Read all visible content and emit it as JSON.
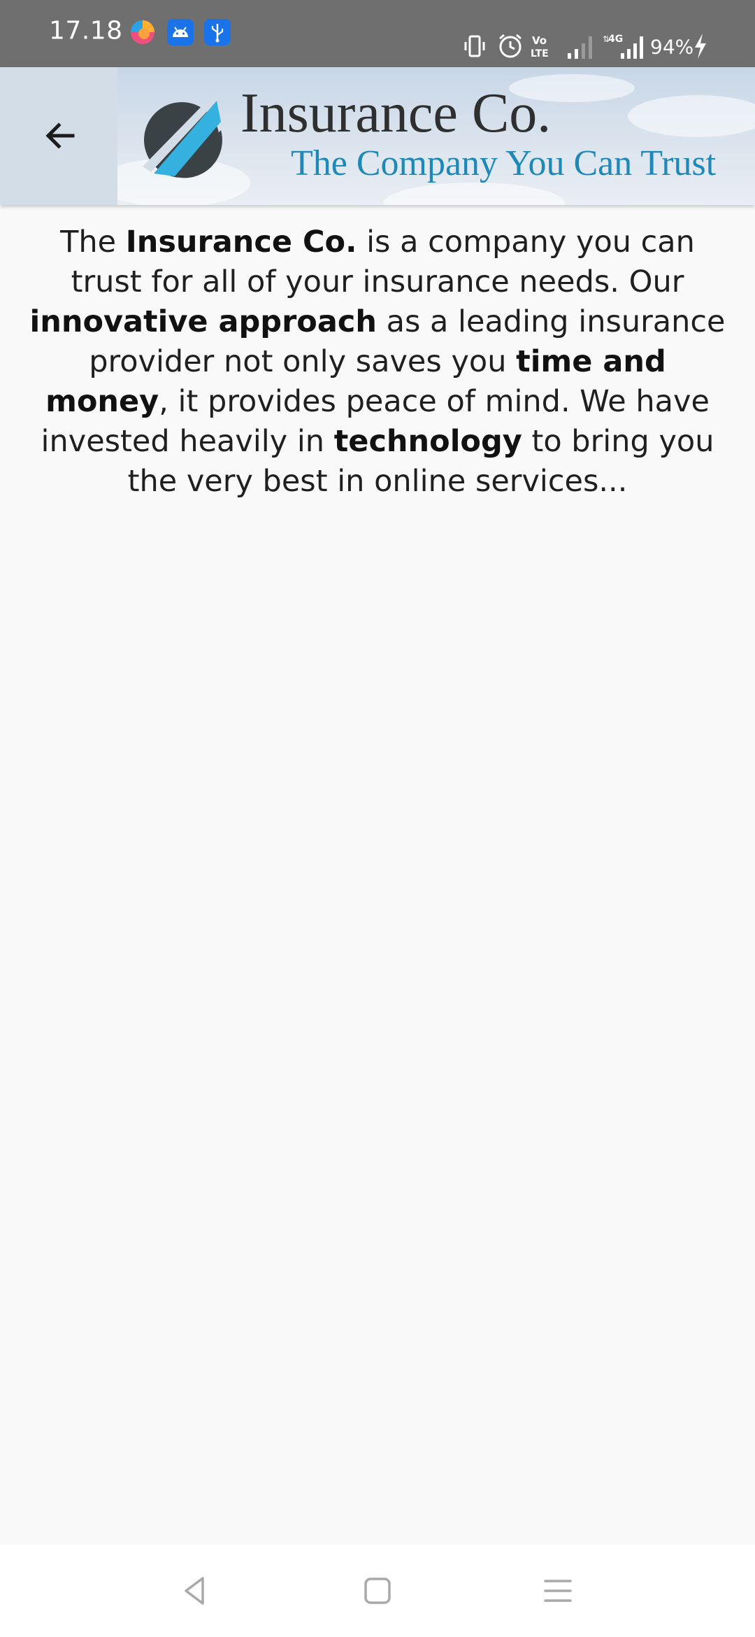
{
  "status_bar": {
    "time": "17.18",
    "battery": "94%",
    "notification_icons": [
      "firefox-icon",
      "android-icon",
      "usb-icon"
    ],
    "system_icons": [
      "vibrate-icon",
      "alarm-icon",
      "volte-icon",
      "signal-icon",
      "4g-signal-icon",
      "charging-icon"
    ],
    "background_color": "#6f6f6f"
  },
  "header": {
    "back_icon": "arrow-left-icon",
    "banner": {
      "name": "Insurance Co.",
      "tagline": "The Company You Can Trust",
      "name_color": "#2f2f2f",
      "tagline_color": "#1e88b8",
      "logo_colors": [
        "#3b4246",
        "#35b1e0"
      ]
    }
  },
  "content": {
    "segments": [
      {
        "text": "The ",
        "bold": false
      },
      {
        "text": "Insurance Co.",
        "bold": true
      },
      {
        "text": " is a company you can trust for all of your insurance needs. Our ",
        "bold": false
      },
      {
        "text": "innovative approach",
        "bold": true
      },
      {
        "text": " as a leading insurance provider not only saves you ",
        "bold": false
      },
      {
        "text": "time and money",
        "bold": true
      },
      {
        "text": ", it provides peace of mind. We have invested heavily in ",
        "bold": false
      },
      {
        "text": "technology",
        "bold": true
      },
      {
        "text": " to bring you the very best in online services...",
        "bold": false
      }
    ]
  },
  "nav_bar": {
    "buttons": [
      "back-triangle-icon",
      "home-square-icon",
      "menu-lines-icon"
    ]
  }
}
